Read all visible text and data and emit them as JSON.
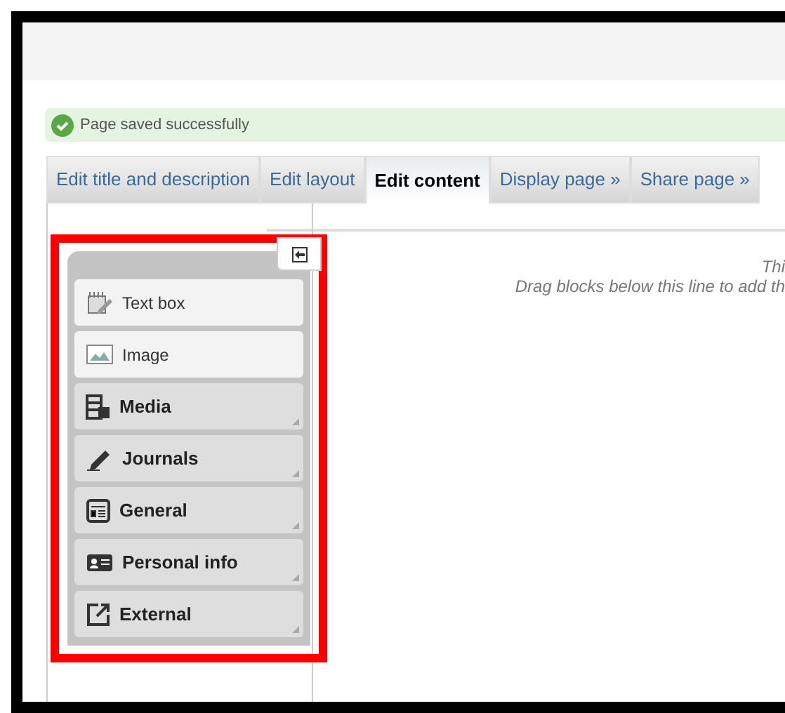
{
  "message": {
    "text": "Page saved successfully"
  },
  "tabs": [
    {
      "label": "Edit title and description",
      "selected": false
    },
    {
      "label": "Edit layout",
      "selected": false
    },
    {
      "label": "Edit content",
      "selected": true
    },
    {
      "label": "Display page »",
      "selected": false
    },
    {
      "label": "Share page »",
      "selected": false
    }
  ],
  "palette": [
    {
      "kind": "block",
      "label": "Text box"
    },
    {
      "kind": "block",
      "label": "Image"
    },
    {
      "kind": "category",
      "label": "Media"
    },
    {
      "kind": "category",
      "label": "Journals"
    },
    {
      "kind": "category",
      "label": "General"
    },
    {
      "kind": "category",
      "label": "Personal info"
    },
    {
      "kind": "category",
      "label": "External"
    }
  ],
  "drop_area": {
    "lines": [
      "Thi",
      "Drag blocks below this line to add th"
    ]
  }
}
